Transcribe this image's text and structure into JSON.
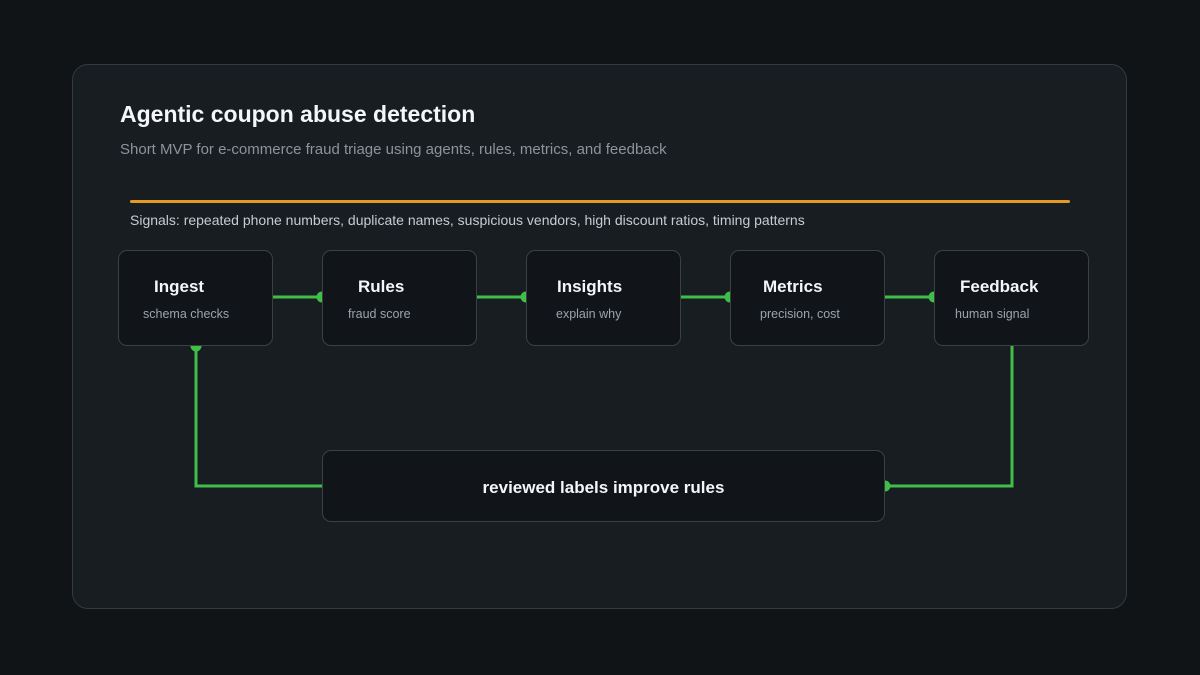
{
  "diagram": {
    "title": "Agentic coupon abuse detection",
    "subtitle": "Short MVP for e-commerce fraud triage using agents, rules, metrics, and feedback",
    "signals": "Signals: repeated phone numbers, duplicate names, suspicious vendors, high discount ratios, timing patterns",
    "stages": [
      {
        "label": "Ingest",
        "sublabel": "schema checks"
      },
      {
        "label": "Rules",
        "sublabel": "fraud score"
      },
      {
        "label": "Insights",
        "sublabel": "explain why"
      },
      {
        "label": "Metrics",
        "sublabel": "precision, cost"
      },
      {
        "label": "Feedback",
        "sublabel": "human signal"
      }
    ],
    "feedback_loop": {
      "label": "reviewed labels improve rules"
    }
  },
  "colors": {
    "accent_line": "#e39b22",
    "connector": "#3fbf4a",
    "card_border": "#333a40",
    "node_border": "#3a423f"
  }
}
